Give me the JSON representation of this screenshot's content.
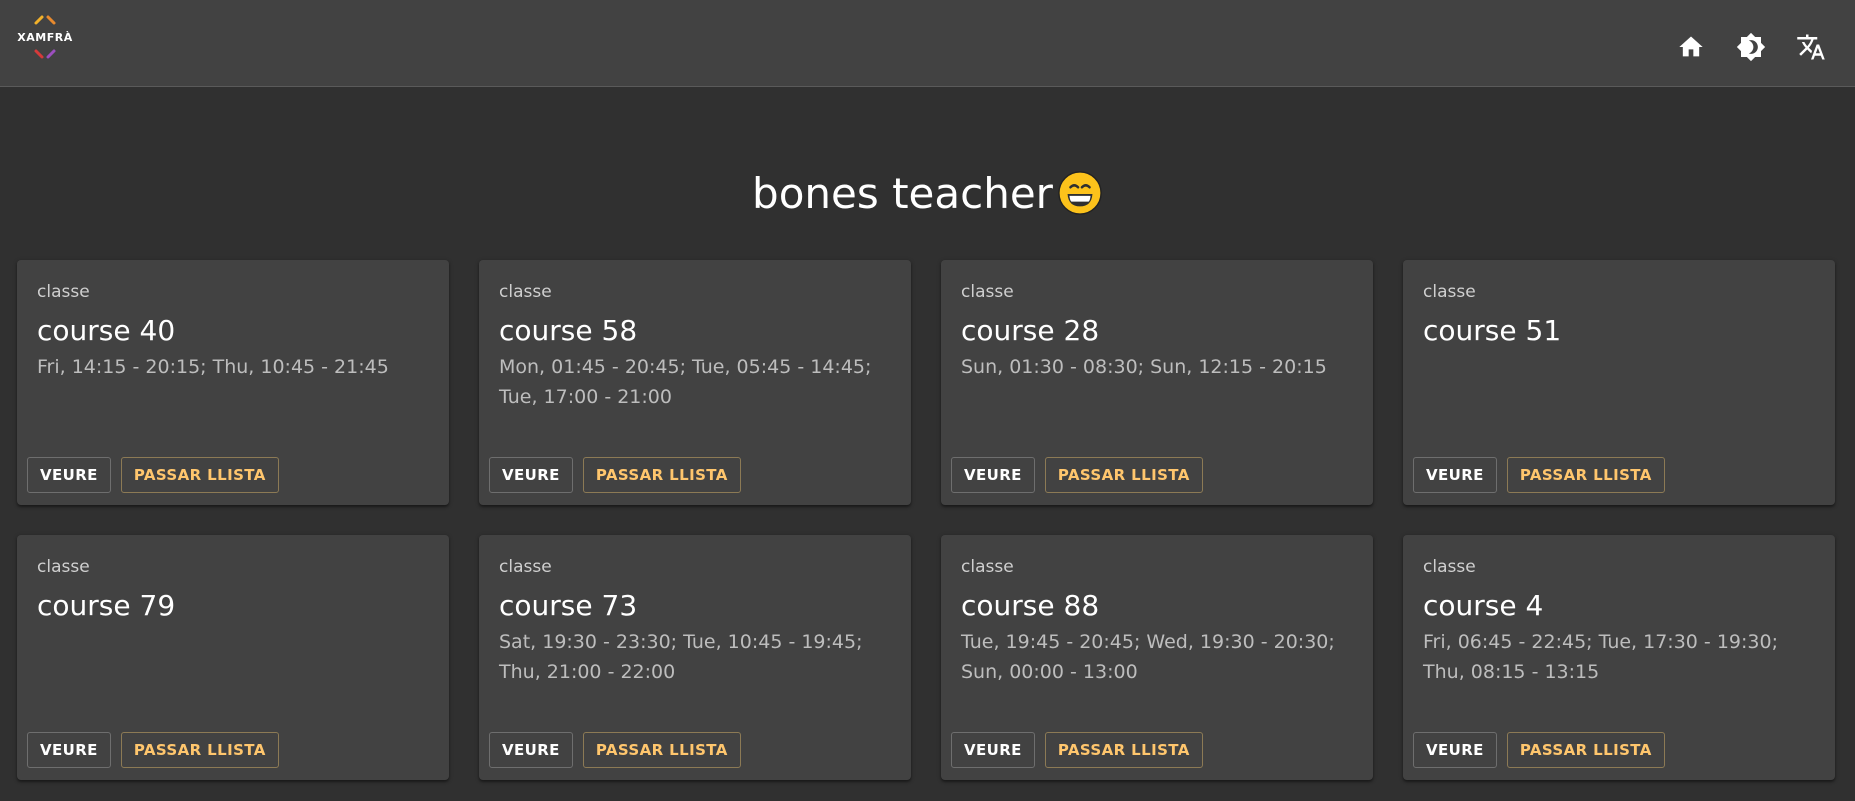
{
  "app": {
    "logo_text": "XAMFRÀ",
    "icons": [
      "home-icon",
      "brightness-icon",
      "translate-icon"
    ]
  },
  "page": {
    "title": "bones teacher",
    "emoji": "grinning-face-emoji"
  },
  "colors": {
    "background": "#303030",
    "topbar": "#424242",
    "card": "#424242",
    "accent": "#ffc66d"
  },
  "cards": [
    {
      "overline": "classe",
      "title": "course 40",
      "schedule": "Fri, 14:15 - 20:15; Thu, 10:45 - 21:45",
      "view_label": "VEURE",
      "list_label": "PASSAR LLISTA"
    },
    {
      "overline": "classe",
      "title": "course 58",
      "schedule": "Mon, 01:45 - 20:45; Tue, 05:45 - 14:45; Tue, 17:00 - 21:00",
      "view_label": "VEURE",
      "list_label": "PASSAR LLISTA"
    },
    {
      "overline": "classe",
      "title": "course 28",
      "schedule": "Sun, 01:30 - 08:30; Sun, 12:15 - 20:15",
      "view_label": "VEURE",
      "list_label": "PASSAR LLISTA"
    },
    {
      "overline": "classe",
      "title": "course 51",
      "schedule": "",
      "view_label": "VEURE",
      "list_label": "PASSAR LLISTA"
    },
    {
      "overline": "classe",
      "title": "course 79",
      "schedule": "",
      "view_label": "VEURE",
      "list_label": "PASSAR LLISTA"
    },
    {
      "overline": "classe",
      "title": "course 73",
      "schedule": "Sat, 19:30 - 23:30; Tue, 10:45 - 19:45; Thu, 21:00 - 22:00",
      "view_label": "VEURE",
      "list_label": "PASSAR LLISTA"
    },
    {
      "overline": "classe",
      "title": "course 88",
      "schedule": "Tue, 19:45 - 20:45; Wed, 19:30 - 20:30; Sun, 00:00 - 13:00",
      "view_label": "VEURE",
      "list_label": "PASSAR LLISTA"
    },
    {
      "overline": "classe",
      "title": "course 4",
      "schedule": "Fri, 06:45 - 22:45; Tue, 17:30 - 19:30; Thu, 08:15 - 13:15",
      "view_label": "VEURE",
      "list_label": "PASSAR LLISTA"
    }
  ]
}
